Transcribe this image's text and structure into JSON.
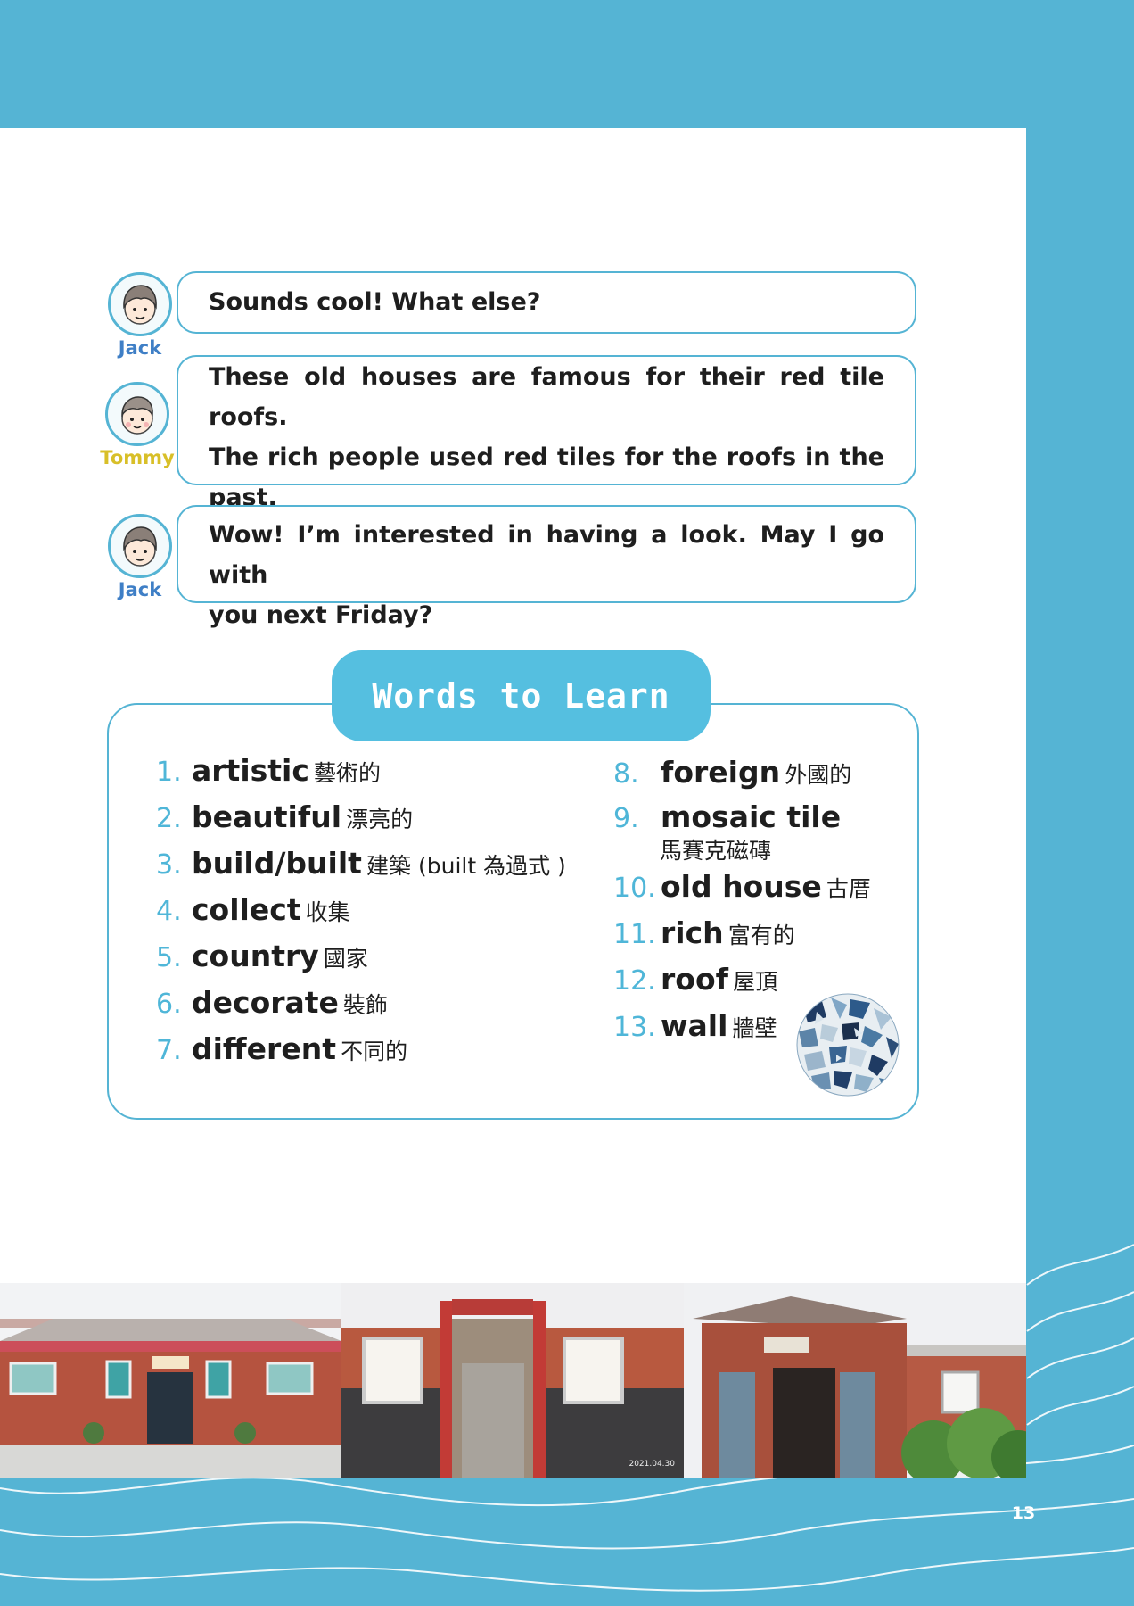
{
  "dialogue": [
    {
      "speaker": "Jack",
      "lines": [
        "Sounds cool!  What else?"
      ]
    },
    {
      "speaker": "Tommy",
      "lines": [
        "These old houses are famous for their red tile roofs.",
        "The rich people used red tiles for the roofs in the",
        "past."
      ]
    },
    {
      "speaker": "Jack",
      "lines": [
        "Wow!  I’m interested in having a look.  May I go with",
        "you next Friday?"
      ]
    }
  ],
  "words_to_learn": {
    "title": "Words to Learn",
    "items": [
      {
        "num": "1.",
        "word": "artistic",
        "meaning": "藝術的"
      },
      {
        "num": "2.",
        "word": "beautiful",
        "meaning": "漂亮的"
      },
      {
        "num": "3.",
        "word": "build/built",
        "meaning": "建築 (built 為過式 )"
      },
      {
        "num": "4.",
        "word": "collect",
        "meaning": "收集"
      },
      {
        "num": "5.",
        "word": "country",
        "meaning": "國家"
      },
      {
        "num": "6.",
        "word": "decorate",
        "meaning": "裝飾"
      },
      {
        "num": "7.",
        "word": "different",
        "meaning": "不同的"
      },
      {
        "num": "8.",
        "word": "foreign",
        "meaning": "外國的"
      },
      {
        "num": "9.",
        "word": "mosaic tile",
        "meaning": "馬賽克磁磚"
      },
      {
        "num": "10.",
        "word": "old house",
        "meaning": "古厝"
      },
      {
        "num": "11.",
        "word": "rich",
        "meaning": "富有的"
      },
      {
        "num": "12.",
        "word": "roof",
        "meaning": "屋頂"
      },
      {
        "num": "13.",
        "word": "wall",
        "meaning": "牆壁"
      }
    ]
  },
  "photos": [
    {
      "icon": "red-brick-old-house-photo"
    },
    {
      "icon": "courtyard-gate-photo",
      "caption": "2021.04.30"
    },
    {
      "icon": "old-house-gate-with-garden-photo"
    }
  ],
  "page_number": "13",
  "colors": {
    "accent": "#55b4d4",
    "title_bg": "#55bfe0",
    "number": "#4fb6d8",
    "jack": "#3f7fc6",
    "tommy": "#d8bf28",
    "brick": "#b5533f"
  }
}
